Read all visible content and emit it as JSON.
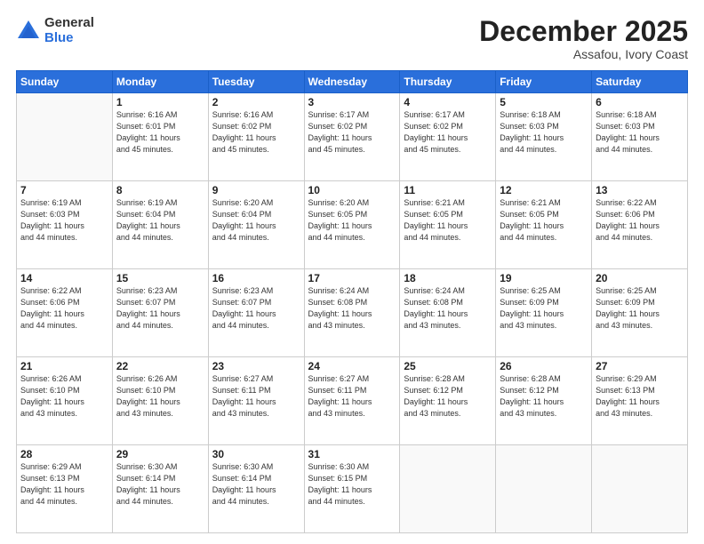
{
  "logo": {
    "general": "General",
    "blue": "Blue"
  },
  "header": {
    "month": "December 2025",
    "location": "Assafou, Ivory Coast"
  },
  "days_of_week": [
    "Sunday",
    "Monday",
    "Tuesday",
    "Wednesday",
    "Thursday",
    "Friday",
    "Saturday"
  ],
  "weeks": [
    [
      {
        "day": "",
        "info": ""
      },
      {
        "day": "1",
        "info": "Sunrise: 6:16 AM\nSunset: 6:01 PM\nDaylight: 11 hours\nand 45 minutes."
      },
      {
        "day": "2",
        "info": "Sunrise: 6:16 AM\nSunset: 6:02 PM\nDaylight: 11 hours\nand 45 minutes."
      },
      {
        "day": "3",
        "info": "Sunrise: 6:17 AM\nSunset: 6:02 PM\nDaylight: 11 hours\nand 45 minutes."
      },
      {
        "day": "4",
        "info": "Sunrise: 6:17 AM\nSunset: 6:02 PM\nDaylight: 11 hours\nand 45 minutes."
      },
      {
        "day": "5",
        "info": "Sunrise: 6:18 AM\nSunset: 6:03 PM\nDaylight: 11 hours\nand 44 minutes."
      },
      {
        "day": "6",
        "info": "Sunrise: 6:18 AM\nSunset: 6:03 PM\nDaylight: 11 hours\nand 44 minutes."
      }
    ],
    [
      {
        "day": "7",
        "info": "Sunrise: 6:19 AM\nSunset: 6:03 PM\nDaylight: 11 hours\nand 44 minutes."
      },
      {
        "day": "8",
        "info": "Sunrise: 6:19 AM\nSunset: 6:04 PM\nDaylight: 11 hours\nand 44 minutes."
      },
      {
        "day": "9",
        "info": "Sunrise: 6:20 AM\nSunset: 6:04 PM\nDaylight: 11 hours\nand 44 minutes."
      },
      {
        "day": "10",
        "info": "Sunrise: 6:20 AM\nSunset: 6:05 PM\nDaylight: 11 hours\nand 44 minutes."
      },
      {
        "day": "11",
        "info": "Sunrise: 6:21 AM\nSunset: 6:05 PM\nDaylight: 11 hours\nand 44 minutes."
      },
      {
        "day": "12",
        "info": "Sunrise: 6:21 AM\nSunset: 6:05 PM\nDaylight: 11 hours\nand 44 minutes."
      },
      {
        "day": "13",
        "info": "Sunrise: 6:22 AM\nSunset: 6:06 PM\nDaylight: 11 hours\nand 44 minutes."
      }
    ],
    [
      {
        "day": "14",
        "info": "Sunrise: 6:22 AM\nSunset: 6:06 PM\nDaylight: 11 hours\nand 44 minutes."
      },
      {
        "day": "15",
        "info": "Sunrise: 6:23 AM\nSunset: 6:07 PM\nDaylight: 11 hours\nand 44 minutes."
      },
      {
        "day": "16",
        "info": "Sunrise: 6:23 AM\nSunset: 6:07 PM\nDaylight: 11 hours\nand 44 minutes."
      },
      {
        "day": "17",
        "info": "Sunrise: 6:24 AM\nSunset: 6:08 PM\nDaylight: 11 hours\nand 43 minutes."
      },
      {
        "day": "18",
        "info": "Sunrise: 6:24 AM\nSunset: 6:08 PM\nDaylight: 11 hours\nand 43 minutes."
      },
      {
        "day": "19",
        "info": "Sunrise: 6:25 AM\nSunset: 6:09 PM\nDaylight: 11 hours\nand 43 minutes."
      },
      {
        "day": "20",
        "info": "Sunrise: 6:25 AM\nSunset: 6:09 PM\nDaylight: 11 hours\nand 43 minutes."
      }
    ],
    [
      {
        "day": "21",
        "info": "Sunrise: 6:26 AM\nSunset: 6:10 PM\nDaylight: 11 hours\nand 43 minutes."
      },
      {
        "day": "22",
        "info": "Sunrise: 6:26 AM\nSunset: 6:10 PM\nDaylight: 11 hours\nand 43 minutes."
      },
      {
        "day": "23",
        "info": "Sunrise: 6:27 AM\nSunset: 6:11 PM\nDaylight: 11 hours\nand 43 minutes."
      },
      {
        "day": "24",
        "info": "Sunrise: 6:27 AM\nSunset: 6:11 PM\nDaylight: 11 hours\nand 43 minutes."
      },
      {
        "day": "25",
        "info": "Sunrise: 6:28 AM\nSunset: 6:12 PM\nDaylight: 11 hours\nand 43 minutes."
      },
      {
        "day": "26",
        "info": "Sunrise: 6:28 AM\nSunset: 6:12 PM\nDaylight: 11 hours\nand 43 minutes."
      },
      {
        "day": "27",
        "info": "Sunrise: 6:29 AM\nSunset: 6:13 PM\nDaylight: 11 hours\nand 43 minutes."
      }
    ],
    [
      {
        "day": "28",
        "info": "Sunrise: 6:29 AM\nSunset: 6:13 PM\nDaylight: 11 hours\nand 44 minutes."
      },
      {
        "day": "29",
        "info": "Sunrise: 6:30 AM\nSunset: 6:14 PM\nDaylight: 11 hours\nand 44 minutes."
      },
      {
        "day": "30",
        "info": "Sunrise: 6:30 AM\nSunset: 6:14 PM\nDaylight: 11 hours\nand 44 minutes."
      },
      {
        "day": "31",
        "info": "Sunrise: 6:30 AM\nSunset: 6:15 PM\nDaylight: 11 hours\nand 44 minutes."
      },
      {
        "day": "",
        "info": ""
      },
      {
        "day": "",
        "info": ""
      },
      {
        "day": "",
        "info": ""
      }
    ]
  ]
}
